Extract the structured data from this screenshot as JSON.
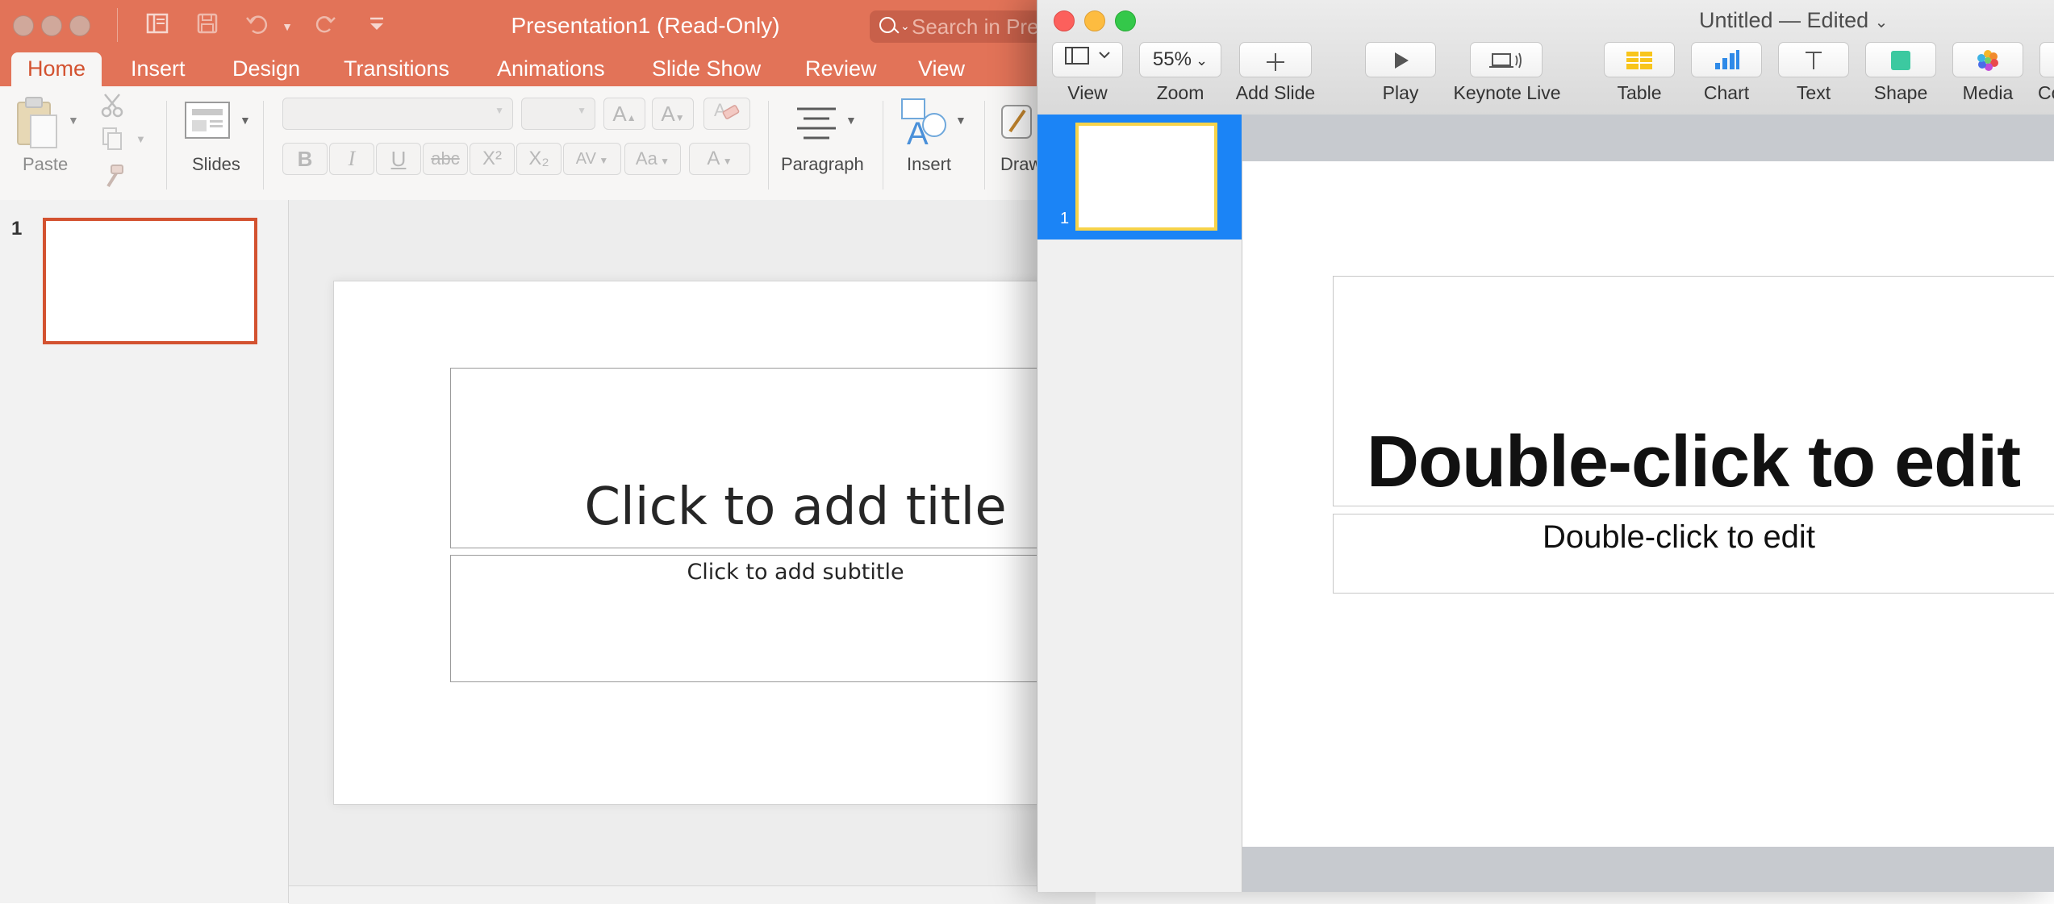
{
  "powerpoint": {
    "window_title": "Presentation1 (Read-Only)",
    "search_placeholder": "Search in Pre",
    "tabs": [
      {
        "label": "Home"
      },
      {
        "label": "Insert"
      },
      {
        "label": "Design"
      },
      {
        "label": "Transitions"
      },
      {
        "label": "Animations"
      },
      {
        "label": "Slide Show"
      },
      {
        "label": "Review"
      },
      {
        "label": "View"
      }
    ],
    "active_tab": "Home",
    "ribbon": {
      "paste_label": "Paste",
      "slides_label": "Slides",
      "paragraph_label": "Paragraph",
      "insert_label": "Insert",
      "draw_label": "Draw",
      "bold": "B",
      "italic": "I",
      "underline": "U",
      "strikethrough": "abc",
      "superscript": "X²",
      "subscript": "X₂",
      "char_spacing": "AV",
      "change_case": "Aa",
      "font_color": "A",
      "grow_font": "A",
      "shrink_font": "A"
    },
    "thumbnail_number": "1",
    "slide": {
      "title_placeholder": "Click to add title",
      "subtitle_placeholder": "Click to add subtitle"
    },
    "colors": {
      "accent": "#D35230",
      "titlebar": "#E27358"
    }
  },
  "keynote": {
    "window_title": "Untitled — Edited",
    "toolbar": [
      {
        "label": "View",
        "icon": "sidebar-icon"
      },
      {
        "label": "Zoom",
        "value": "55%"
      },
      {
        "label": "Add Slide",
        "icon": "plus-icon"
      },
      {
        "label": "Play",
        "icon": "play-icon"
      },
      {
        "label": "Keynote Live",
        "icon": "keynote-live-icon"
      },
      {
        "label": "Table",
        "icon": "table-icon"
      },
      {
        "label": "Chart",
        "icon": "chart-icon"
      },
      {
        "label": "Text",
        "icon": "text-icon"
      },
      {
        "label": "Shape",
        "icon": "shape-icon"
      },
      {
        "label": "Media",
        "icon": "media-icon"
      },
      {
        "label": "Co",
        "icon": "comment-icon"
      }
    ],
    "thumbnail_number": "1",
    "slide": {
      "title_placeholder": "Double-click to edit",
      "subtitle_placeholder": "Double-click to edit"
    },
    "colors": {
      "selection": "#1B84F6",
      "thumb_border": "#F7D34A"
    }
  }
}
